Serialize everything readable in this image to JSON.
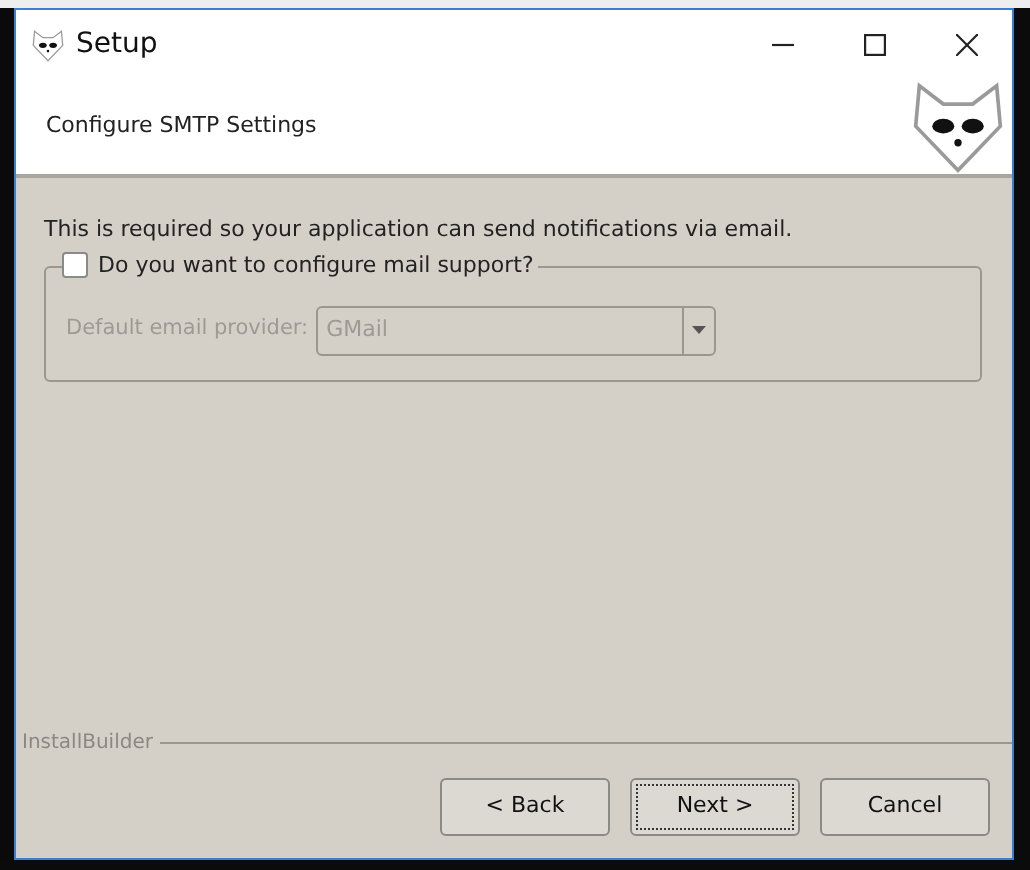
{
  "window": {
    "title": "Setup"
  },
  "header": {
    "title": "Configure SMTP Settings"
  },
  "description": "This is required so your application can send notifications via email.",
  "mail_group": {
    "checkbox": {
      "label": "Do you want to configure mail support?",
      "checked": false
    },
    "provider": {
      "label": "Default email provider:",
      "value": "GMail",
      "disabled": true
    }
  },
  "brand": "InstallBuilder",
  "buttons": [
    {
      "label": "< Back",
      "focused": false
    },
    {
      "label": "Next >",
      "focused": true
    },
    {
      "label": "Cancel",
      "focused": false
    }
  ]
}
